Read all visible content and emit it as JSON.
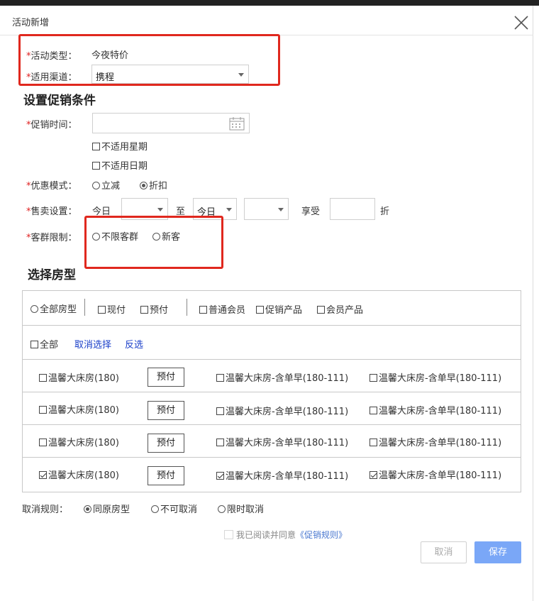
{
  "dialog": {
    "title": "活动新增"
  },
  "basic": {
    "activity_type_label": "*活动类型：",
    "activity_type_value": "今夜特价",
    "channel_label": "*适用渠道：",
    "channel_value": "携程"
  },
  "promo": {
    "section_title": "设置促销条件",
    "time_label": "*促销时间：",
    "exclude_weekday": "不适用星期",
    "exclude_date": "不适用日期",
    "mode_label": "*优惠模式：",
    "mode_options": [
      "立减",
      "折扣"
    ],
    "mode_selected": "折扣",
    "sale_label": "*售卖设置：",
    "sale_from_text": "今日",
    "sale_to_sep": "至",
    "sale_to_value": "今日",
    "sale_enjoy": "享受",
    "sale_discount_unit": "折",
    "group_label": "*客群限制：",
    "group_options": [
      "不限客群",
      "新客"
    ]
  },
  "rooms": {
    "section_title": "选择房型",
    "filters": [
      "全部房型",
      "现付",
      "预付",
      "普通会员",
      "促销产品",
      "会员产品"
    ],
    "select_all": "全部",
    "cancel_select": "取消选择",
    "invert_select": "反选",
    "rows": [
      {
        "room": "温馨大床房(180)",
        "pay": "预付",
        "p1": "温馨大床房-含单早(180-111)",
        "p2": "温馨大床房-含单早(180-111)",
        "checked": false
      },
      {
        "room": "温馨大床房(180)",
        "pay": "预付",
        "p1": "温馨大床房-含单早(180-111)",
        "p2": "温馨大床房-含单早(180-111)",
        "checked": false
      },
      {
        "room": "温馨大床房(180)",
        "pay": "预付",
        "p1": "温馨大床房-含单早(180-111)",
        "p2": "温馨大床房-含单早(180-111)",
        "checked": false
      },
      {
        "room": "温馨大床房(180)",
        "pay": "预付",
        "p1": "温馨大床房-含单早(180-111)",
        "p2": "温馨大床房-含单早(180-111)",
        "checked": true
      }
    ]
  },
  "cancel_rule": {
    "label": "取消规则：",
    "options": [
      "同原房型",
      "不可取消",
      "限时取消"
    ],
    "selected": "同原房型"
  },
  "agreement": {
    "text": "我已阅读并同意",
    "link": "《促销规则》"
  },
  "actions": {
    "cancel": "取消",
    "save": "保存"
  },
  "colors": {
    "highlight": "#e0281e",
    "primary": "#7aa7f7",
    "link": "#1a3fc9",
    "required": "#e02020"
  },
  "icons": {
    "close": "close-icon",
    "calendar": "calendar-icon",
    "dropdown": "chevron-down-icon"
  }
}
